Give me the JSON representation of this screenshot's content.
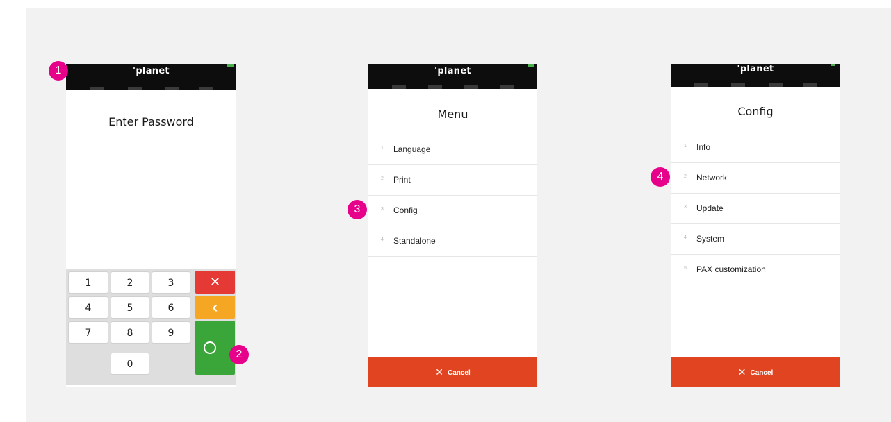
{
  "brand": "'planet",
  "screens": {
    "password": {
      "title": "Enter Password",
      "keys": [
        "1",
        "2",
        "3",
        "4",
        "5",
        "6",
        "7",
        "8",
        "9",
        "0"
      ],
      "clear_glyph": "✕",
      "back_glyph": "‹"
    },
    "menu": {
      "title": "Menu",
      "items": [
        {
          "num": "1",
          "label": "Language"
        },
        {
          "num": "2",
          "label": "Print"
        },
        {
          "num": "3",
          "label": "Config"
        },
        {
          "num": "4",
          "label": "Standalone"
        }
      ],
      "cancel_label": "Cancel"
    },
    "config": {
      "title": "Config",
      "items": [
        {
          "num": "1",
          "label": "Info"
        },
        {
          "num": "2",
          "label": "Network"
        },
        {
          "num": "3",
          "label": "Update"
        },
        {
          "num": "4",
          "label": "System"
        },
        {
          "num": "5",
          "label": "PAX customization"
        }
      ],
      "cancel_label": "Cancel"
    }
  },
  "badges": [
    "1",
    "2",
    "3",
    "4"
  ],
  "colors": {
    "badge": "#e6008a",
    "cancel": "#e04420",
    "key_clear": "#e53935",
    "key_back": "#f5a623",
    "key_ok": "#3aa63a",
    "topbar": "#0d0d0d"
  }
}
